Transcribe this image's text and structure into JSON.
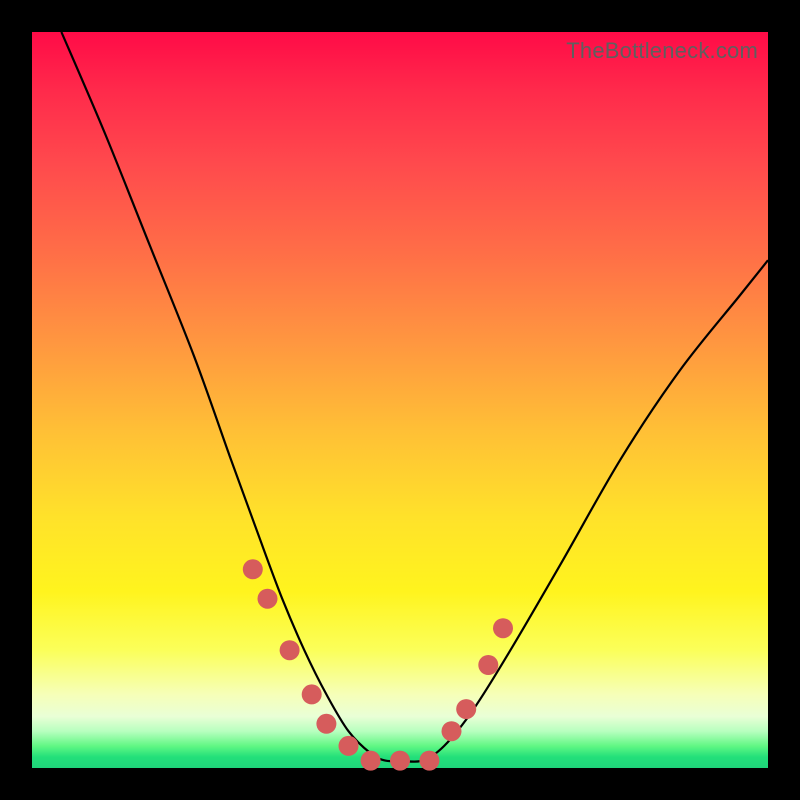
{
  "attribution": "TheBottleneck.com",
  "colors": {
    "curve": "#000000",
    "marker_fill": "#d65c5c",
    "marker_stroke": "#b94848"
  },
  "chart_data": {
    "type": "line",
    "title": "",
    "xlabel": "",
    "ylabel": "",
    "xlim": [
      0,
      100
    ],
    "ylim": [
      0,
      100
    ],
    "grid": false,
    "legend": false,
    "annotations": [
      "TheBottleneck.com"
    ],
    "series": [
      {
        "name": "bottleneck-curve",
        "x": [
          4,
          10,
          16,
          22,
          27,
          31,
          34,
          37,
          40,
          43,
          46,
          48,
          50,
          53,
          56,
          60,
          65,
          72,
          80,
          88,
          96,
          100
        ],
        "y": [
          100,
          86,
          71,
          56,
          42,
          31,
          23,
          16,
          10,
          5,
          2,
          1,
          1,
          1,
          3,
          8,
          16,
          28,
          42,
          54,
          64,
          69
        ]
      }
    ],
    "markers": {
      "name": "highlight-points",
      "x": [
        30,
        32,
        35,
        38,
        40,
        43,
        46,
        50,
        54,
        57,
        59,
        62,
        64
      ],
      "y": [
        27,
        23,
        16,
        10,
        6,
        3,
        1,
        1,
        1,
        5,
        8,
        14,
        19
      ]
    }
  }
}
